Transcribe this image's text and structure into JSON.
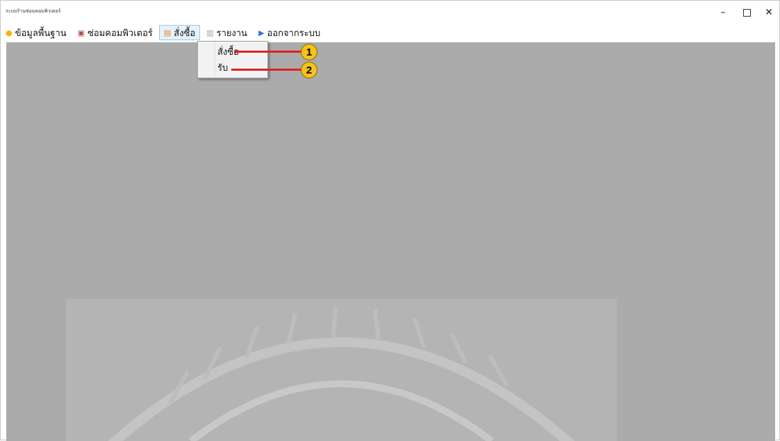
{
  "window": {
    "title": "ระบบร้านซ่อมคอมพิวเตอร์",
    "minimize_glyph": "–",
    "close_glyph": "✕"
  },
  "menubar": {
    "items": [
      {
        "label": "ข้อมูลพื้นฐาน",
        "icon": "lightbulb-icon"
      },
      {
        "label": "ซ่อมคอมพิวเตอร์",
        "icon": "monitor-icon"
      },
      {
        "label": "สั่งซื้อ",
        "icon": "order-icon"
      },
      {
        "label": "รายงาน",
        "icon": "report-icon"
      },
      {
        "label": "ออกจากระบบ",
        "icon": "exit-icon"
      }
    ],
    "active_index": 2
  },
  "dropdown": {
    "items": [
      {
        "label": "สั่งซื้อ"
      },
      {
        "label": "รับ"
      }
    ]
  },
  "callouts": [
    {
      "number": "1"
    },
    {
      "number": "2"
    }
  ],
  "colors": {
    "mdi_background": "#ababab",
    "callout_line": "#e0201e",
    "callout_badge": "#f7c21b",
    "menu_active_bg": "#e5f1fb"
  }
}
